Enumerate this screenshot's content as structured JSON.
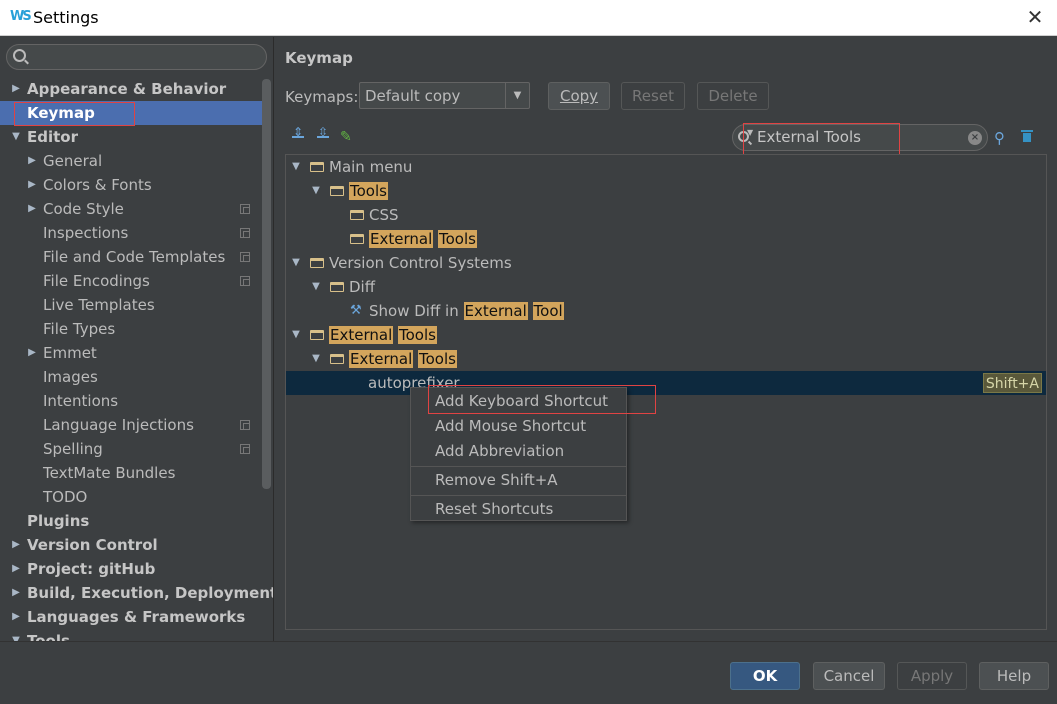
{
  "window": {
    "title": "Settings",
    "app_icon": "WS"
  },
  "sidebar": {
    "search": {
      "value": "",
      "placeholder": ""
    },
    "items": [
      {
        "label": "Appearance & Behavior",
        "level": 0,
        "arrow": "▶",
        "bold": true
      },
      {
        "label": "Keymap",
        "level": 0,
        "arrow": "",
        "bold": true,
        "selected": true
      },
      {
        "label": "Editor",
        "level": 0,
        "arrow": "▼",
        "bold": true
      },
      {
        "label": "General",
        "level": 1,
        "arrow": "▶"
      },
      {
        "label": "Colors & Fonts",
        "level": 1,
        "arrow": "▶"
      },
      {
        "label": "Code Style",
        "level": 1,
        "arrow": "▶",
        "copy": true
      },
      {
        "label": "Inspections",
        "level": 1,
        "arrow": "",
        "copy": true
      },
      {
        "label": "File and Code Templates",
        "level": 1,
        "arrow": "",
        "copy": true
      },
      {
        "label": "File Encodings",
        "level": 1,
        "arrow": "",
        "copy": true
      },
      {
        "label": "Live Templates",
        "level": 1,
        "arrow": ""
      },
      {
        "label": "File Types",
        "level": 1,
        "arrow": ""
      },
      {
        "label": "Emmet",
        "level": 1,
        "arrow": "▶"
      },
      {
        "label": "Images",
        "level": 1,
        "arrow": ""
      },
      {
        "label": "Intentions",
        "level": 1,
        "arrow": ""
      },
      {
        "label": "Language Injections",
        "level": 1,
        "arrow": "",
        "copy": true
      },
      {
        "label": "Spelling",
        "level": 1,
        "arrow": "",
        "copy": true
      },
      {
        "label": "TextMate Bundles",
        "level": 1,
        "arrow": ""
      },
      {
        "label": "TODO",
        "level": 1,
        "arrow": ""
      },
      {
        "label": "Plugins",
        "level": 0,
        "arrow": "",
        "bold": true
      },
      {
        "label": "Version Control",
        "level": 0,
        "arrow": "▶",
        "bold": true
      },
      {
        "label": "Project: gitHub",
        "level": 0,
        "arrow": "▶",
        "bold": true
      },
      {
        "label": "Build, Execution, Deployment",
        "level": 0,
        "arrow": "▶",
        "bold": true
      },
      {
        "label": "Languages & Frameworks",
        "level": 0,
        "arrow": "▶",
        "bold": true
      },
      {
        "label": "Tools",
        "level": 0,
        "arrow": "▼",
        "bold": true
      }
    ]
  },
  "main": {
    "title": "Keymap",
    "keymaps_label": "Keymaps:",
    "keymaps_value": "Default copy",
    "buttons": {
      "copy": "Copy",
      "reset": "Reset",
      "delete": "Delete"
    },
    "filter": {
      "value": "External Tools"
    },
    "tree": [
      {
        "level": 0,
        "arrow": "▼",
        "icon": "folder",
        "parts": [
          {
            "t": "Main menu",
            "m": false
          }
        ]
      },
      {
        "level": 1,
        "arrow": "▼",
        "icon": "folder",
        "parts": [
          {
            "t": "Tools",
            "m": true
          }
        ]
      },
      {
        "level": 2,
        "arrow": "",
        "icon": "folder",
        "parts": [
          {
            "t": "CSS",
            "m": false
          }
        ]
      },
      {
        "level": 2,
        "arrow": "",
        "icon": "folder",
        "parts": [
          {
            "t": "External",
            "m": true
          },
          {
            "t": " ",
            "m": false
          },
          {
            "t": "Tools",
            "m": true
          }
        ]
      },
      {
        "level": 0,
        "arrow": "▼",
        "icon": "folder",
        "parts": [
          {
            "t": "Version Control Systems",
            "m": false
          }
        ]
      },
      {
        "level": 1,
        "arrow": "▼",
        "icon": "folder",
        "parts": [
          {
            "t": "Diff",
            "m": false
          }
        ]
      },
      {
        "level": 2,
        "arrow": "",
        "icon": "tool",
        "parts": [
          {
            "t": "Show Diff in ",
            "m": false
          },
          {
            "t": "External",
            "m": true
          },
          {
            "t": " ",
            "m": false
          },
          {
            "t": "Tool",
            "m": true
          }
        ]
      },
      {
        "level": 0,
        "arrow": "▼",
        "icon": "folder",
        "parts": [
          {
            "t": "External",
            "m": true
          },
          {
            "t": " ",
            "m": false
          },
          {
            "t": "Tools",
            "m": true
          }
        ]
      },
      {
        "level": 1,
        "arrow": "▼",
        "icon": "folder",
        "parts": [
          {
            "t": "External",
            "m": true
          },
          {
            "t": " ",
            "m": false
          },
          {
            "t": "Tools",
            "m": true
          }
        ]
      },
      {
        "level": 2,
        "arrow": "",
        "icon": "",
        "selected": true,
        "shortcut": "Shift+A",
        "parts": [
          {
            "t": "autoprefixer",
            "m": false
          }
        ]
      }
    ]
  },
  "context_menu": {
    "items": [
      {
        "label": "Add Keyboard Shortcut",
        "group": 0
      },
      {
        "label": "Add Mouse Shortcut",
        "group": 0
      },
      {
        "label": "Add Abbreviation",
        "group": 0
      },
      {
        "label": "Remove Shift+A",
        "group": 1
      },
      {
        "label": "Reset Shortcuts",
        "group": 2
      }
    ]
  },
  "footer": {
    "ok": "OK",
    "cancel": "Cancel",
    "apply": "Apply",
    "help": "Help"
  },
  "colors": {
    "accent": "#4b6eaf",
    "highlight": "#d3a55c",
    "annotation": "#e04343"
  }
}
